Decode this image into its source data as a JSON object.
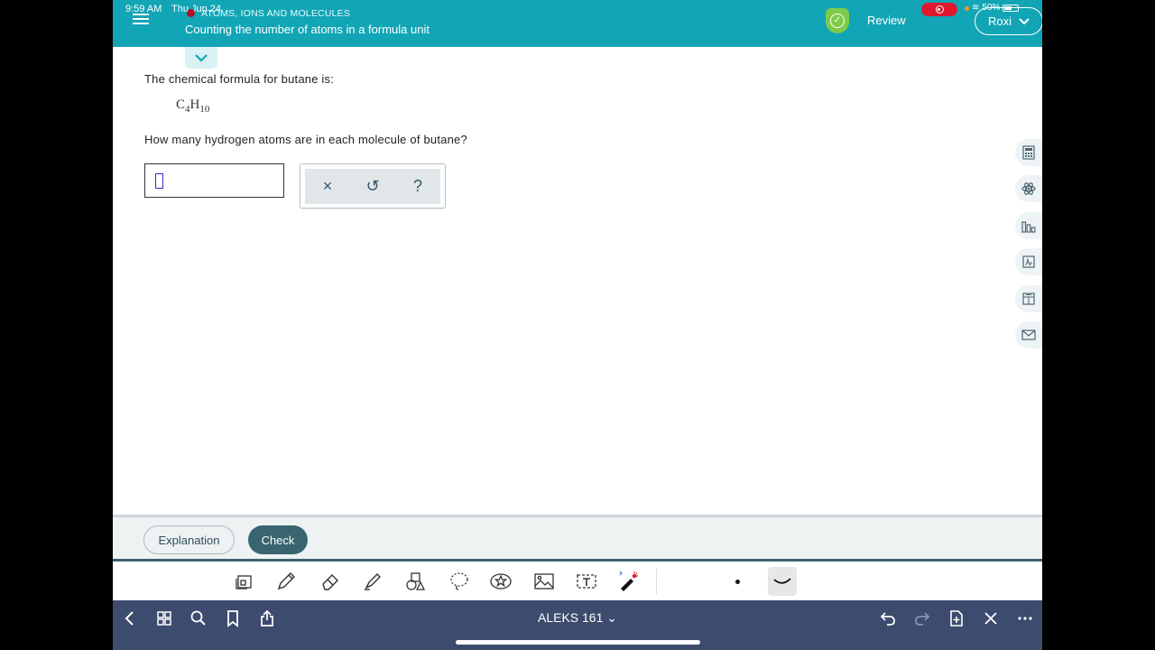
{
  "status": {
    "time": "9:59 AM",
    "date": "Thu Jun 24",
    "battery": "50%"
  },
  "header": {
    "topic": "ATOMS, IONS AND MOLECULES",
    "lesson": "Counting the number of atoms in a formula unit",
    "review_label": "Review",
    "user_name": "Roxi"
  },
  "question": {
    "intro": "The chemical formula for butane is:",
    "formula": {
      "element1": "C",
      "count1": "4",
      "element2": "H",
      "count2": "10"
    },
    "prompt": "How many hydrogen atoms are in each molecule of butane?",
    "answer_value": ""
  },
  "tool_panel": {
    "clear": "×",
    "undo": "↺",
    "help": "?"
  },
  "right_rail": [
    "calculator-icon",
    "periodic-atom-icon",
    "chart-icon",
    "periodic-table-icon",
    "reference-icon",
    "mail-icon"
  ],
  "bottom": {
    "explanation_label": "Explanation",
    "check_label": "Check"
  },
  "os": {
    "doc_title": "ALEKS 161 ⌄"
  },
  "colors": {
    "header": "#12a5b5",
    "check": "#38656f",
    "os_bar": "#3d4b6e",
    "review_badge": "#7ecb4a"
  }
}
